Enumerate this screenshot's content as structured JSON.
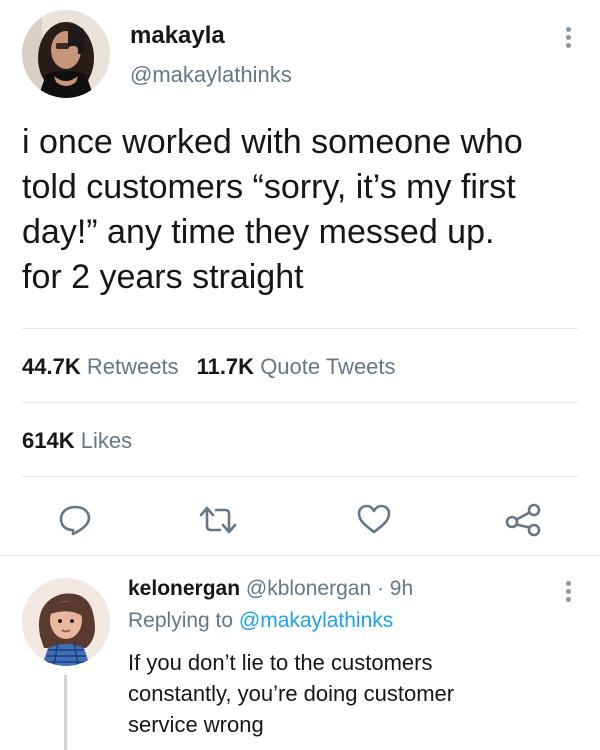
{
  "tweet": {
    "author": {
      "name": "makayla",
      "handle": "@makaylathinks"
    },
    "text_lines": [
      "i once worked with someone who",
      "told customers “sorry, it’s my first",
      "day!” any time they messed up.",
      "for 2 years straight"
    ],
    "stats": {
      "retweets_count": "44.7K",
      "retweets_label": "Retweets",
      "quotes_count": "11.7K",
      "quotes_label": "Quote Tweets",
      "likes_count": "614K",
      "likes_label": "Likes"
    },
    "actions": {
      "icons": [
        "reply-icon",
        "retweet-icon",
        "like-icon",
        "share-icon"
      ]
    }
  },
  "reply": {
    "name": "kelonergan",
    "handle": "@kblonergan",
    "separator": " · ",
    "time": "9h",
    "replying_prefix": "Replying to ",
    "replying_to": "@makaylathinks",
    "text_lines": [
      "If you don’t lie to the customers",
      "constantly, you’re doing customer",
      "service wrong"
    ]
  },
  "colors": {
    "text": "#14171a",
    "secondary": "#657786",
    "link": "#1da1f2",
    "divider": "#e1e8ed"
  }
}
